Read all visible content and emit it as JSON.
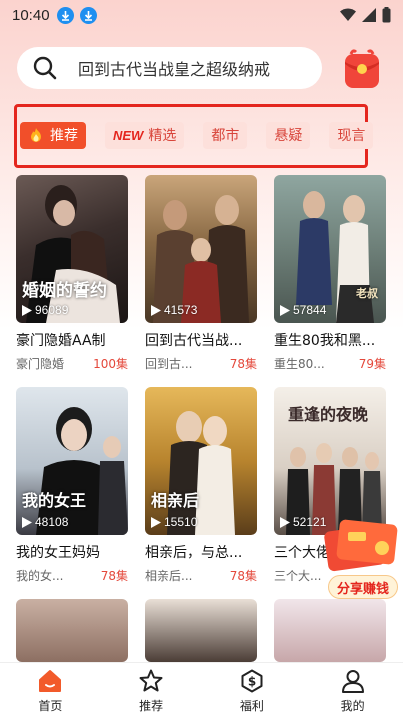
{
  "status_bar": {
    "time": "10:40"
  },
  "search": {
    "text": "回到古代当战皇之超级纳戒"
  },
  "tabs": [
    {
      "label": "推荐",
      "active": true
    },
    {
      "label": "精选",
      "badge": "NEW"
    },
    {
      "label": "都市"
    },
    {
      "label": "悬疑"
    },
    {
      "label": "现言"
    }
  ],
  "cards": [
    {
      "title": "豪门隐婚AA制",
      "desc": "豪门隐婚",
      "episodes": "100集",
      "plays": "96089",
      "poster_text": "婚姻的誓约"
    },
    {
      "title": "回到古代当战...",
      "desc": "回到古...",
      "episodes": "78集",
      "plays": "41573"
    },
    {
      "title": "重生80我和黑...",
      "desc": "重生80...",
      "episodes": "79集",
      "plays": "57844",
      "poster_text": "老叔"
    },
    {
      "title": "我的女王妈妈",
      "desc": "我的女...",
      "episodes": "78集",
      "plays": "48108",
      "poster_text": "我的女王"
    },
    {
      "title": "相亲后，与总...",
      "desc": "相亲后...",
      "episodes": "78集",
      "plays": "15510",
      "poster_text": "相亲后"
    },
    {
      "title": "三个大佬",
      "desc": "三个大...",
      "episodes": "",
      "plays": "52121",
      "poster_text": "重逢的夜晚"
    }
  ],
  "share": {
    "label": "分享赚钱"
  },
  "nav": [
    {
      "label": "首页",
      "icon": "home-icon",
      "active": true
    },
    {
      "label": "推荐",
      "icon": "star-icon"
    },
    {
      "label": "福利",
      "icon": "dollar-icon"
    },
    {
      "label": "我的",
      "icon": "user-icon"
    }
  ],
  "colors": {
    "accent": "#f14f2a",
    "tab_bg": "#fde0db",
    "highlight_frame": "#e4261e",
    "episode_red": "#e4483b"
  }
}
